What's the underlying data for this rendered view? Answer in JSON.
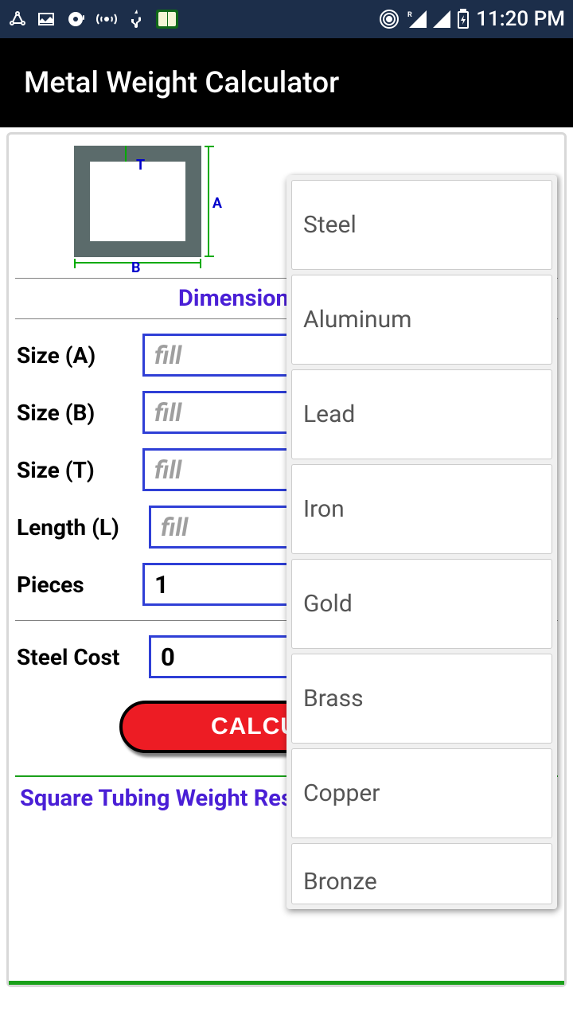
{
  "status": {
    "time": "11:20 PM"
  },
  "app": {
    "title": "Metal Weight Calculator"
  },
  "diagram": {
    "labelA": "A",
    "labelB": "B",
    "labelT": "T"
  },
  "section": {
    "title": "Dimension of Square"
  },
  "form": {
    "sizeA": {
      "label": "Size (A)",
      "placeholder": "fill",
      "value": ""
    },
    "sizeB": {
      "label": "Size (B)",
      "placeholder": "fill",
      "value": ""
    },
    "sizeT": {
      "label": "Size (T)",
      "placeholder": "fill",
      "value": ""
    },
    "length": {
      "label": "Length (L)",
      "placeholder": "fill",
      "value": ""
    },
    "pieces": {
      "label": "Pieces",
      "value": "1"
    },
    "cost": {
      "label": "Steel Cost",
      "value": "0"
    }
  },
  "button": {
    "calculate": "CALCULATE"
  },
  "result": {
    "title": "Square Tubing Weight Result"
  },
  "materials": [
    "Steel",
    "Aluminum",
    "Lead",
    "Iron",
    "Gold",
    "Brass",
    "Copper",
    "Bronze"
  ]
}
